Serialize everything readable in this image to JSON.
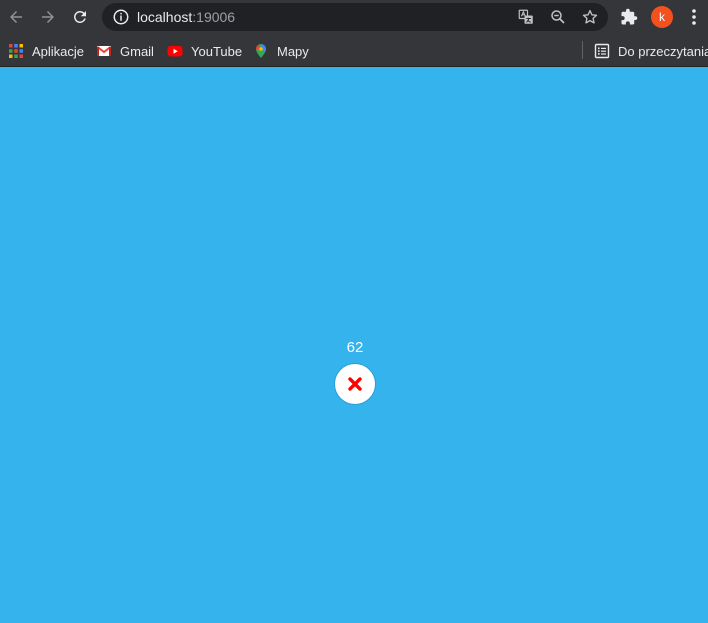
{
  "browser": {
    "url_host": "localhost",
    "url_port": ":19006",
    "profile_initial": "k",
    "icons": {
      "back": "arrow-left-icon",
      "forward": "arrow-right-icon",
      "reload": "reload-icon",
      "site_info": "info-icon",
      "translate": "translate-icon",
      "zoom": "zoom-out-icon",
      "bookmark": "star-icon",
      "extensions": "puzzle-icon",
      "menu": "kebab-menu-icon"
    }
  },
  "bookmarks": {
    "items": [
      {
        "label": "Aplikacje",
        "icon": "apps-grid-icon"
      },
      {
        "label": "Gmail",
        "icon": "gmail-icon"
      },
      {
        "label": "YouTube",
        "icon": "youtube-icon"
      },
      {
        "label": "Mapy",
        "icon": "maps-pin-icon"
      }
    ],
    "reading_list": {
      "label": "Do przeczytania",
      "icon": "reading-list-icon"
    }
  },
  "app": {
    "background": "#35b3ec",
    "counter": "62",
    "close_icon": "close-x-icon",
    "close_color": "#ff0000"
  }
}
